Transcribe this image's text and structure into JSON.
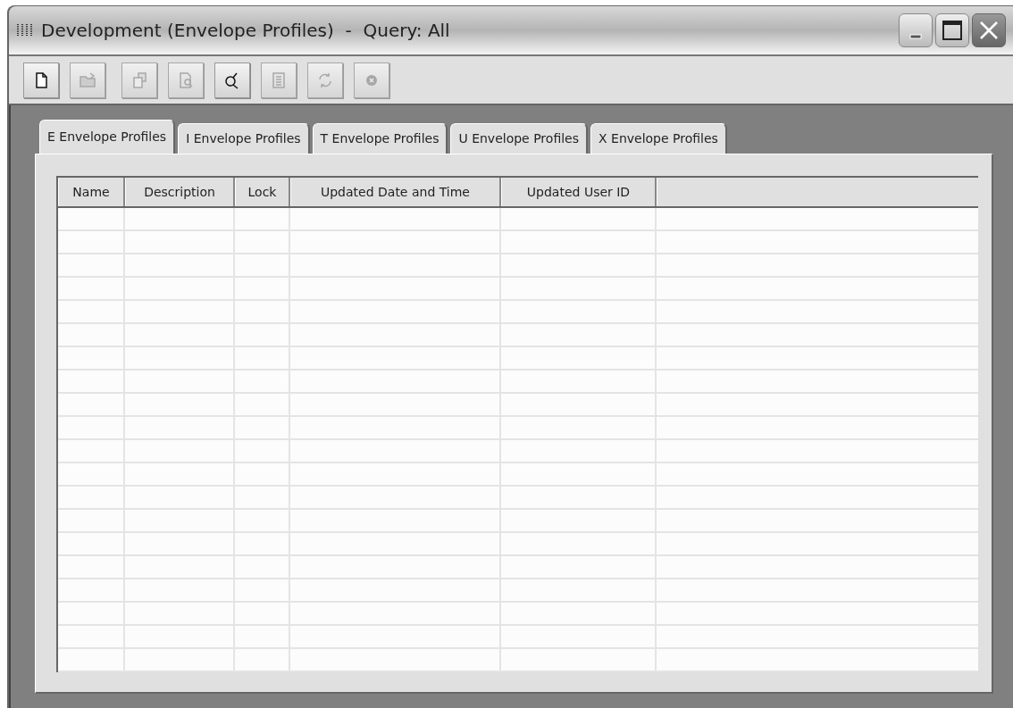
{
  "window": {
    "title": "Development (Envelope Profiles)  -  Query: All"
  },
  "toolbar": [
    {
      "kind": "new",
      "disabled": false
    },
    {
      "kind": "open",
      "disabled": true
    },
    {
      "kind": "copy",
      "disabled": true
    },
    {
      "kind": "preview",
      "disabled": true
    },
    {
      "kind": "find",
      "disabled": false
    },
    {
      "kind": "list",
      "disabled": true
    },
    {
      "kind": "refresh",
      "disabled": true
    },
    {
      "kind": "cancel",
      "disabled": true
    }
  ],
  "tabs": [
    {
      "label": "E Envelope Profiles",
      "selected": true
    },
    {
      "label": "I Envelope Profiles",
      "selected": false
    },
    {
      "label": "T Envelope Profiles",
      "selected": false
    },
    {
      "label": "U Envelope Profiles",
      "selected": false
    },
    {
      "label": "X Envelope Profiles",
      "selected": false
    }
  ],
  "table": {
    "columns": [
      "Name",
      "Description",
      "Lock",
      "Updated Date and Time",
      "Updated User ID"
    ]
  }
}
